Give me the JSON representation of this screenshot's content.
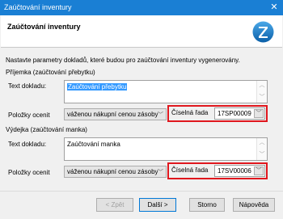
{
  "window": {
    "title": "Zaúčtování inventury",
    "close_glyph": "✕"
  },
  "header": {
    "title": "Zaúčtování inventury",
    "logo_icon": "pohoda-logo-icon"
  },
  "intro": "Nastavte parametry dokladů, které budou pro zaúčtování inventury vygenerovány.",
  "prijemka": {
    "group_label": "Příjemka (zaúčtování přebytku)",
    "text_label": "Text dokladu:",
    "text_value": "Zaúčtování přebytku",
    "items_label": "Položky ocenit",
    "valuation_value": "váženou nákupní cenou zásoby",
    "series_label": "Číselná řada",
    "series_value": "17SP00009"
  },
  "vydejka": {
    "group_label": "Výdejka (zaúčtování manka)",
    "text_label": "Text dokladu:",
    "text_value": "Zaúčtování manka",
    "items_label": "Položky ocenit",
    "valuation_value": "váženou nákupní cenou zásoby",
    "series_label": "Číselná řada",
    "series_value": "17SV00006"
  },
  "buttons": {
    "back_label": "< Zpět",
    "next_label": "Další >",
    "cancel_label": "Storno",
    "help_label": "Nápověda"
  },
  "colors": {
    "titlebar": "#1a7fd4",
    "highlight": "#e0171e",
    "selection": "#3399ff"
  }
}
